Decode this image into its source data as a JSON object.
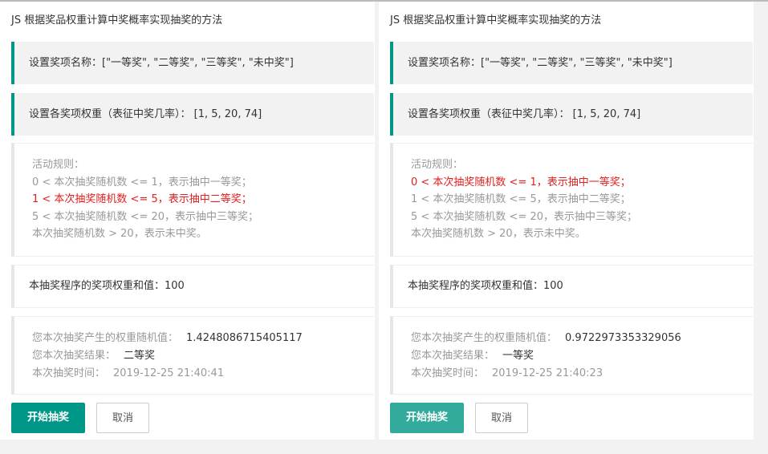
{
  "title": "JS 根据奖品权重计算中奖概率实现抽奖的方法",
  "names": "设置奖项名称：[\"一等奖\", \"二等奖\", \"三等奖\", \"未中奖\"]",
  "weights": "设置各奖项权重（表征中奖几率）： [1, 5, 20, 74]",
  "rules": [
    "活动规则：",
    "0 < 本次抽奖随机数 <= 1，表示抽中一等奖；",
    "1 < 本次抽奖随机数 <= 5，表示抽中二等奖；",
    "5 < 本次抽奖随机数 <= 20，表示抽中三等奖；",
    "本次抽奖随机数 > 20，表示未中奖。"
  ],
  "sum": "本抽奖程序的奖项权重和值：100",
  "labels": {
    "random": "您本次抽奖产生的权重随机值：",
    "result": "您本次抽奖结果：",
    "time": "本次抽奖时间："
  },
  "buttons": {
    "start": "开始抽奖",
    "cancel": "取消"
  },
  "panels": [
    {
      "random": "1.4248086715405117",
      "result": "二等奖",
      "time": "2019-12-25 21:40:41",
      "highlight_rule": 2
    },
    {
      "random": "0.9722973353329056",
      "result": "一等奖",
      "time": "2019-12-25 21:40:23",
      "highlight_rule": 1
    }
  ],
  "colors": {
    "accent": "#009688",
    "highlight": "#e02020"
  }
}
